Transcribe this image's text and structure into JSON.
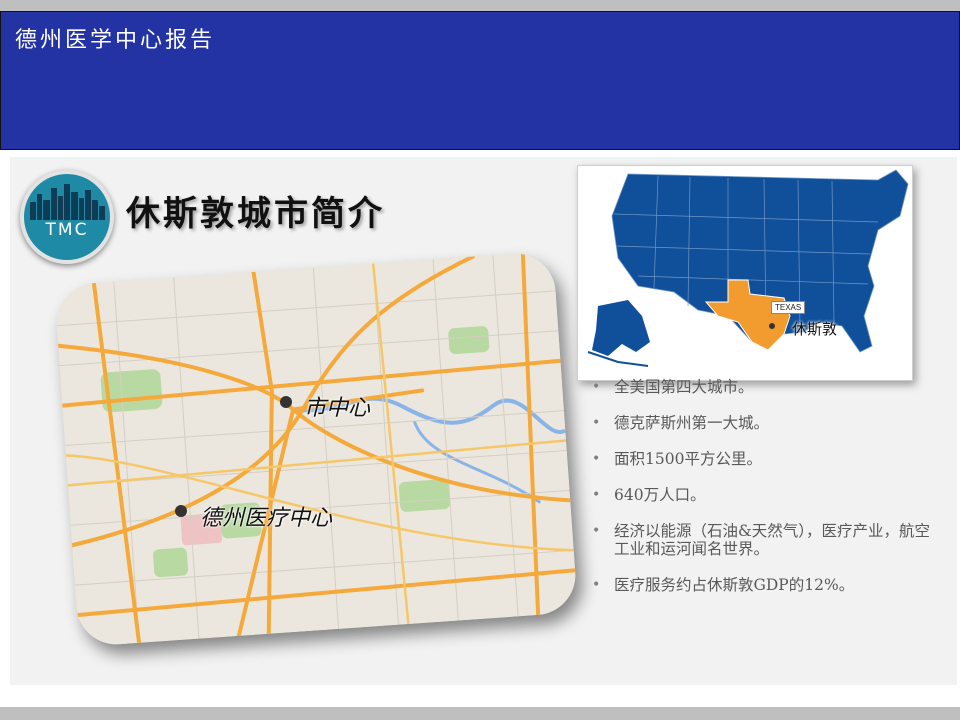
{
  "header": {
    "title": "德州医学中心报告"
  },
  "logo": {
    "text": "TMC"
  },
  "section": {
    "title": "休斯敦城市简介"
  },
  "city_map": {
    "labels": {
      "downtown": "市中心",
      "medical_center": "德州医疗中心"
    },
    "colors": {
      "road": "#f4a93a",
      "park": "#b9d9a3",
      "water": "#8ab4e8",
      "land": "#ebe7de"
    }
  },
  "us_map": {
    "state_tag": "TEXAS",
    "city_label": "休斯敦",
    "colors": {
      "states": "#10509b",
      "texas": "#f29b2e"
    }
  },
  "bullets": [
    "全美国第四大城市。",
    "德克萨斯州第一大城。",
    "面积1500平方公里。",
    "640万人口。",
    "经济以能源（石油&天然气），医疗产业，航空工业和运河闻名世界。",
    "医疗服务约占休斯敦GDP的12%。"
  ],
  "bullet_symbol": "•"
}
